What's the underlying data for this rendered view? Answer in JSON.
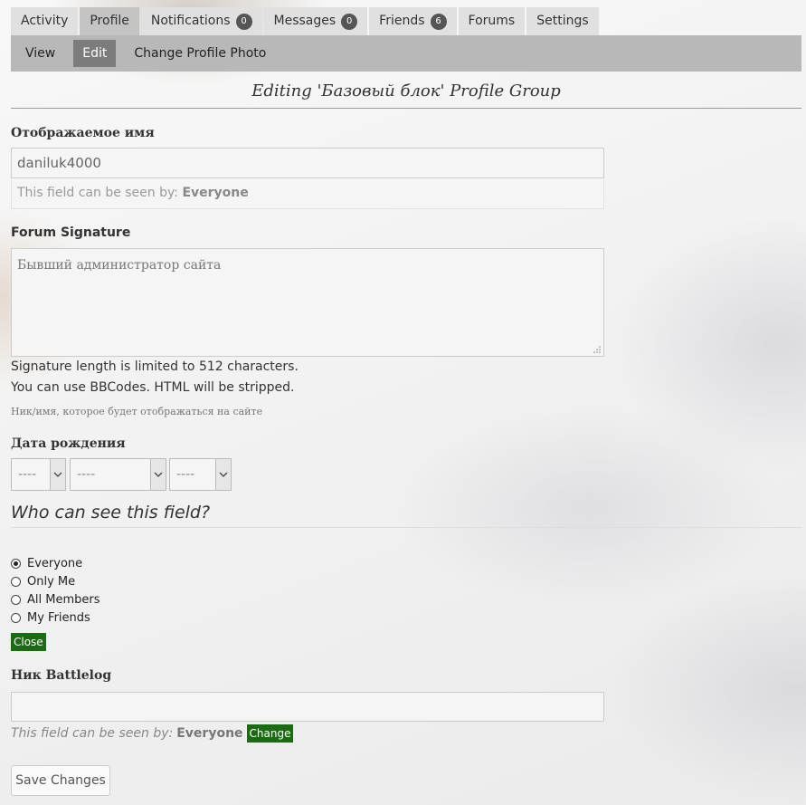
{
  "top_tabs": [
    {
      "label": "Activity"
    },
    {
      "label": "Profile"
    },
    {
      "label": "Notifications",
      "count": "0"
    },
    {
      "label": "Messages",
      "count": "0"
    },
    {
      "label": "Friends",
      "count": "6"
    },
    {
      "label": "Forums"
    },
    {
      "label": "Settings"
    }
  ],
  "sub_tabs": [
    {
      "label": "View"
    },
    {
      "label": "Edit"
    },
    {
      "label": "Change Profile Photo"
    }
  ],
  "page_title": "Editing 'Базовый блок' Profile Group",
  "display_name": {
    "label": "Отображаемое имя",
    "value": "daniluk4000",
    "visibility_prefix": "This field can be seen by:",
    "visibility_value": "Everyone"
  },
  "signature": {
    "label": "Forum Signature",
    "value": "Бывший администратор сайта",
    "note_1": "Signature length is limited to 512 characters.",
    "note_2": "You can use BBCodes. HTML will be stripped.",
    "hint": "Ник/имя, которое будет отображаться на сайте"
  },
  "birthdate": {
    "label": "Дата рождения",
    "day": "----",
    "month": "----",
    "year": "----"
  },
  "visibility_picker": {
    "title": "Who can see this field?",
    "options": [
      "Everyone",
      "Only Me",
      "All Members",
      "My Friends"
    ],
    "selected": "Everyone",
    "close_label": "Close"
  },
  "battlelog": {
    "label": "Ник Battlelog",
    "value": "",
    "visibility_prefix": "This field can be seen by:",
    "visibility_value": "Everyone",
    "change_label": "Change"
  },
  "save_label": "Save Changes",
  "colors": {
    "accent_green": "#1b6b12",
    "subnav_bg": "#b8b8b8",
    "active_subtab": "#7c7c7c"
  }
}
